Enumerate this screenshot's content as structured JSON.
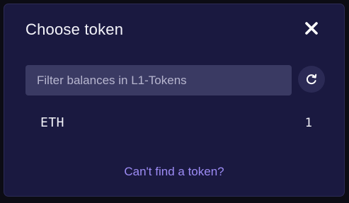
{
  "modal": {
    "title": "Choose token",
    "close_icon": "close-icon",
    "filter": {
      "placeholder": "Filter balances in L1-Tokens",
      "value": ""
    },
    "refresh_icon": "refresh-icon",
    "tokens": [
      {
        "symbol": "ETH",
        "balance": "1"
      }
    ],
    "cant_find_link": "Can't find a token?"
  },
  "colors": {
    "background": "#1a1940",
    "input_bg": "#3a3a63",
    "refresh_bg": "#2b2a55",
    "link": "#9d8cf5",
    "text": "#f4f4fa"
  }
}
